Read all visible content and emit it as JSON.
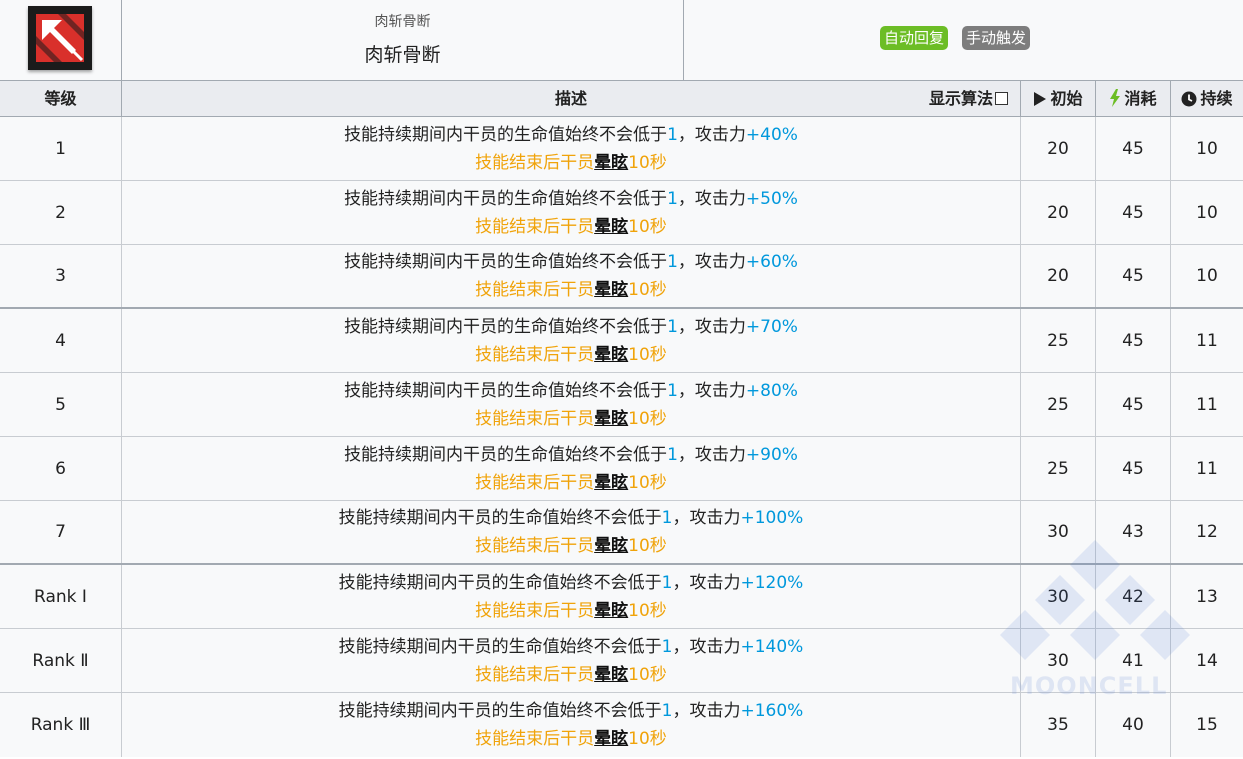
{
  "header": {
    "skill_name_small": "肉斩骨断",
    "skill_name": "肉斩骨断",
    "icon": "skill-icon-red-arrow",
    "tags": [
      {
        "label": "自动回复",
        "color": "#6cbd25"
      },
      {
        "label": "手动触发",
        "color": "#7d7d7d"
      }
    ]
  },
  "columns": {
    "level": "等级",
    "desc": "描述",
    "formula_toggle": "显示算法",
    "initial": "初始",
    "cost": "消耗",
    "duration": "持续"
  },
  "rows": [
    {
      "level": "1",
      "prefix": "技能持续期间内干员的生命值始终不会低于",
      "hp": "1",
      "mid": "，攻击力",
      "atk": "+40%",
      "after_a": "技能结束后干员",
      "kw": "晕眩",
      "after_b": "10秒",
      "initial": "20",
      "cost": "45",
      "duration": "10"
    },
    {
      "level": "2",
      "prefix": "技能持续期间内干员的生命值始终不会低于",
      "hp": "1",
      "mid": "，攻击力",
      "atk": "+50%",
      "after_a": "技能结束后干员",
      "kw": "晕眩",
      "after_b": "10秒",
      "initial": "20",
      "cost": "45",
      "duration": "10"
    },
    {
      "level": "3",
      "prefix": "技能持续期间内干员的生命值始终不会低于",
      "hp": "1",
      "mid": "，攻击力",
      "atk": "+60%",
      "after_a": "技能结束后干员",
      "kw": "晕眩",
      "after_b": "10秒",
      "initial": "20",
      "cost": "45",
      "duration": "10"
    },
    {
      "level": "4",
      "prefix": "技能持续期间内干员的生命值始终不会低于",
      "hp": "1",
      "mid": "，攻击力",
      "atk": "+70%",
      "after_a": "技能结束后干员",
      "kw": "晕眩",
      "after_b": "10秒",
      "initial": "25",
      "cost": "45",
      "duration": "11"
    },
    {
      "level": "5",
      "prefix": "技能持续期间内干员的生命值始终不会低于",
      "hp": "1",
      "mid": "，攻击力",
      "atk": "+80%",
      "after_a": "技能结束后干员",
      "kw": "晕眩",
      "after_b": "10秒",
      "initial": "25",
      "cost": "45",
      "duration": "11"
    },
    {
      "level": "6",
      "prefix": "技能持续期间内干员的生命值始终不会低于",
      "hp": "1",
      "mid": "，攻击力",
      "atk": "+90%",
      "after_a": "技能结束后干员",
      "kw": "晕眩",
      "after_b": "10秒",
      "initial": "25",
      "cost": "45",
      "duration": "11"
    },
    {
      "level": "7",
      "prefix": "技能持续期间内干员的生命值始终不会低于",
      "hp": "1",
      "mid": "，攻击力",
      "atk": "+100%",
      "after_a": "技能结束后干员",
      "kw": "晕眩",
      "after_b": "10秒",
      "initial": "30",
      "cost": "43",
      "duration": "12"
    },
    {
      "level": "Rank Ⅰ",
      "prefix": "技能持续期间内干员的生命值始终不会低于",
      "hp": "1",
      "mid": "，攻击力",
      "atk": "+120%",
      "after_a": "技能结束后干员",
      "kw": "晕眩",
      "after_b": "10秒",
      "initial": "30",
      "cost": "42",
      "duration": "13"
    },
    {
      "level": "Rank Ⅱ",
      "prefix": "技能持续期间内干员的生命值始终不会低于",
      "hp": "1",
      "mid": "，攻击力",
      "atk": "+140%",
      "after_a": "技能结束后干员",
      "kw": "晕眩",
      "after_b": "10秒",
      "initial": "30",
      "cost": "41",
      "duration": "14"
    },
    {
      "level": "Rank Ⅲ",
      "prefix": "技能持续期间内干员的生命值始终不会低于",
      "hp": "1",
      "mid": "，攻击力",
      "atk": "+160%",
      "after_a": "技能结束后干员",
      "kw": "晕眩",
      "after_b": "10秒",
      "initial": "35",
      "cost": "40",
      "duration": "15"
    }
  ],
  "watermark": {
    "text": "MOONCELL"
  },
  "colors": {
    "accent_number": "#0098dc",
    "orange_text": "#f0a30a",
    "header_bg": "#eaecf0"
  }
}
